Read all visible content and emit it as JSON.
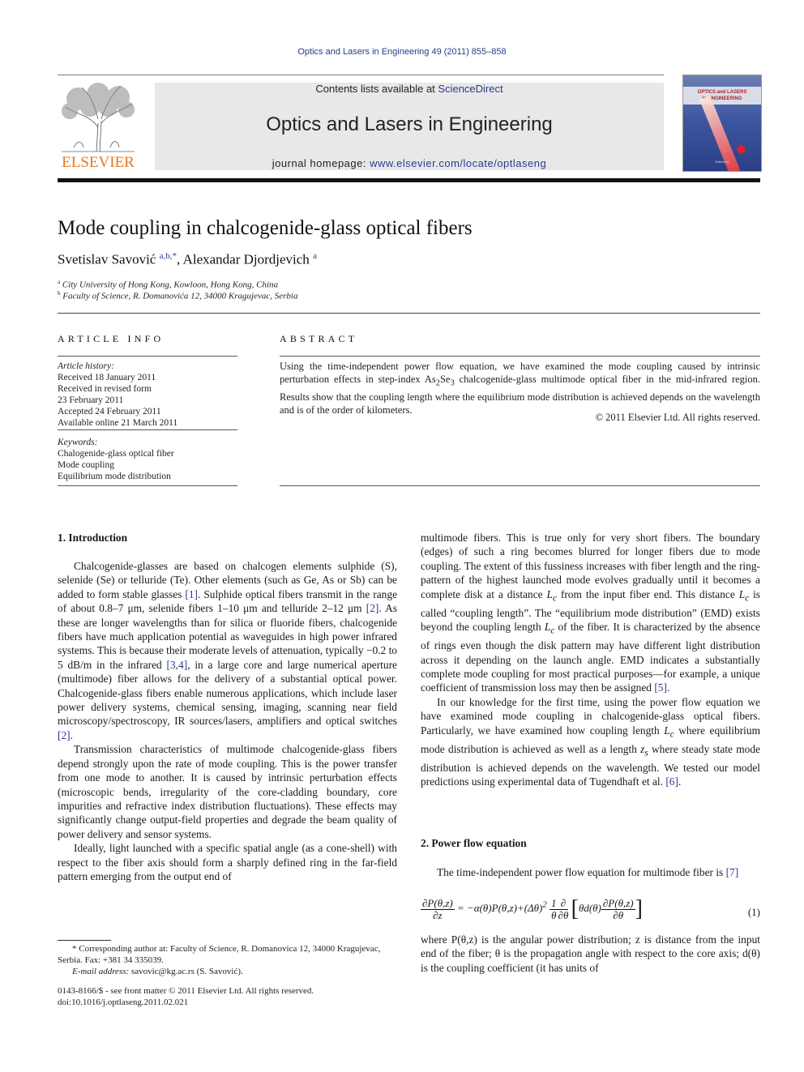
{
  "running_head": "Optics and Lasers in Engineering 49 (2011) 855–858",
  "masthead": {
    "publisher_logo_text": "ELSEVIER",
    "contents_prefix": "Contents lists available at ",
    "contents_link": "ScienceDirect",
    "journal_title": "Optics and Lasers in Engineering",
    "homepage_prefix": "journal homepage: ",
    "homepage_link": "www.elsevier.com/locate/optlaseng",
    "cover": {
      "title_line1": "OPTICS and LASERS",
      "title_line2": "in ENGINEERING",
      "editor_line": "Edited by"
    }
  },
  "article": {
    "title": "Mode coupling in chalcogenide-glass optical fibers",
    "authors": [
      {
        "name": "Svetislav Savović",
        "sup": "a,b,*"
      },
      {
        "name": "Alexandar Djordjevich",
        "sup": "a"
      }
    ],
    "affiliations": [
      {
        "key": "a",
        "text": "City University of Hong Kong, Kowloon, Hong Kong, China"
      },
      {
        "key": "b",
        "text": "Faculty of Science, R. Domanovića 12, 34000 Kragujevac, Serbia"
      }
    ]
  },
  "article_info": {
    "heading": "ARTICLE INFO",
    "history_label": "Article history:",
    "history": [
      "Received 18 January 2011",
      "Received in revised form",
      "23 February 2011",
      "Accepted 24 February 2011",
      "Available online 21 March 2011"
    ],
    "keywords_label": "Keywords:",
    "keywords": [
      "Chalogenide-glass optical fiber",
      "Mode coupling",
      "Equilibrium mode distribution"
    ]
  },
  "abstract": {
    "heading": "ABSTRACT",
    "text_part1": "Using the time-independent power flow equation, we have examined the mode coupling caused by intrinsic perturbation effects in step-index As",
    "sub1": "2",
    "text_part2": "Se",
    "sub2": "3",
    "text_part3": " chalcogenide-glass multimode optical fiber in the mid-infrared region. Results show that the coupling length where the equilibrium mode distribution is achieved depends on the wavelength and is of the order of kilometers.",
    "copyright": "© 2011 Elsevier Ltd. All rights reserved."
  },
  "sections": {
    "intro": {
      "heading": "1.  Introduction",
      "p1_a": "Chalcogenide-glasses are based on chalcogen elements sulphide (S), selenide (Se) or telluride (Te). Other elements (such as Ge, As or Sb) can be added to form stable glasses ",
      "p1_ref1": "[1]",
      "p1_b": ". Sulphide optical fibers transmit in the range of about 0.8–7 μm, selenide fibers 1–10 μm and telluride 2–12 μm ",
      "p1_ref2": "[2]",
      "p1_c": ". As these are longer wavelengths than for silica or fluoride fibers, chalcogenide fibers have much application potential as waveguides in high power infrared systems. This is because their moderate levels of attenuation, typically −0.2 to 5 dB/m in the infrared ",
      "p1_ref3": "[3,4]",
      "p1_d": ", in a large core and large numerical aperture (multimode) fiber allows for the delivery of a substantial optical power. Chalcogenide-glass fibers enable numerous applications, which include laser power delivery systems, chemical sensing, imaging, scanning near field microscopy/spectroscopy, IR sources/lasers, amplifiers and optical switches ",
      "p1_ref4": "[2]",
      "p1_e": ".",
      "p2": "Transmission characteristics of multimode chalcogenide-glass fibers depend strongly upon the rate of mode coupling. This is the power transfer from one mode to another. It is caused by intrinsic perturbation effects (microscopic bends, irregularity of the core-cladding boundary, core impurities and refractive index distribution fluctuations). These effects may significantly change output-field properties and degrade the beam quality of power delivery and sensor systems.",
      "p3_left": "Ideally, light launched with a specific spatial angle (as a cone-shell) with respect to the fiber axis should form a sharply defined ring in the far-field pattern emerging from the output end of",
      "p3_right_a": "multimode fibers. This is true only for very short fibers. The boundary (edges) of such a ring becomes blurred for longer fibers due to mode coupling. The extent of this fussiness increases with fiber length and the ring-pattern of the highest launched mode evolves gradually until it becomes a complete disk at a distance ",
      "Lc": "L",
      "Lc_sub": "c",
      "p3_right_b": " from the input fiber end. This distance ",
      "p3_right_c": " is called “coupling length”. The “equilibrium mode distribution” (EMD) exists beyond the coupling length ",
      "p3_right_d": " of the fiber. It is characterized by the absence of rings even though the disk pattern may have different light distribution across it depending on the launch angle. EMD indicates a substantially complete mode coupling for most practical purposes—for example, a unique coefficient of transmission loss may then be assigned ",
      "p3_ref": "[5]",
      "p3_end": ".",
      "p4_a": "In our knowledge for the first time, using the power flow equation we have examined mode coupling in chalcogenide-glass optical fibers. Particularly, we have examined how coupling length ",
      "p4_b": " where equilibrium mode distribution is achieved as well as a length ",
      "zs": "z",
      "zs_sub": "s",
      "p4_c": " where steady state mode distribution is achieved depends on the wavelength. We tested our model predictions using experimental data of Tugendhaft et al. ",
      "p4_ref": "[6]",
      "p4_end": "."
    },
    "power_flow": {
      "heading": "2.  Power flow equation",
      "p1_a": "The time-independent power flow equation for multimode fiber is ",
      "p1_ref": "[7]",
      "equation": {
        "lhs_num": "∂P(θ,z)",
        "lhs_den": "∂z",
        "rhs_1": "= −α(θ)P(θ,z)+(Δθ)",
        "rhs_sq": "2",
        "frac1_num": "1",
        "frac1_den": "θ",
        "frac2_num": "∂",
        "frac2_den": "∂θ",
        "bracket_a": "θd(θ)",
        "frac3_num": "∂P(θ,z)",
        "frac3_den": "∂θ",
        "number": "(1)"
      },
      "p2": "where P(θ,z) is the angular power distribution; z is distance from the input end of the fiber; θ is the propagation angle with respect to the core axis; d(θ) is the coupling coefficient (it has units of"
    }
  },
  "footnotes": {
    "corresponding": "* Corresponding author at: Faculty of Science, R. Domanovica 12, 34000 Kragujevac, Serbia. Fax: +381 34 335039.",
    "email_label": "E-mail address:",
    "email": " savovic@kg.ac.rs (S. Savović).",
    "front_matter": "0143-8166/$ - see front matter © 2011 Elsevier Ltd. All rights reserved.",
    "doi": "doi:10.1016/j.optlaseng.2011.02.021"
  }
}
